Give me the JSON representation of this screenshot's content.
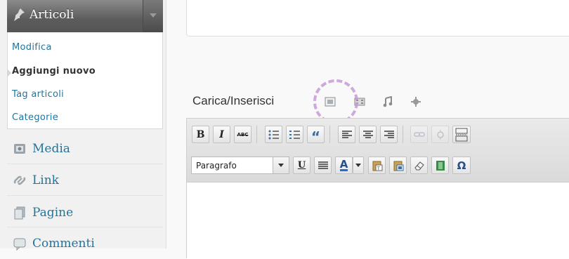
{
  "sidebar": {
    "header": {
      "label": "Articoli",
      "icon": "pushpin-icon"
    },
    "submenu": [
      {
        "label": "Modifica",
        "current": false
      },
      {
        "label": "Aggiungi nuovo",
        "current": true
      },
      {
        "label": "Tag articoli",
        "current": false
      },
      {
        "label": "Categorie",
        "current": false
      }
    ],
    "items": [
      {
        "label": "Media",
        "icon": "media-icon"
      },
      {
        "label": "Link",
        "icon": "link-icon"
      },
      {
        "label": "Pagine",
        "icon": "pages-icon"
      },
      {
        "label": "Commenti",
        "icon": "comments-icon"
      }
    ]
  },
  "upload": {
    "label": "Carica/Inserisci",
    "icons": [
      "add-image-icon",
      "add-video-icon",
      "add-audio-icon",
      "add-media-icon"
    ]
  },
  "editor": {
    "toolbar_row1": [
      "bold",
      "italic",
      "strikethrough",
      "bullet-list",
      "numbered-list",
      "blockquote",
      "align-left",
      "align-center",
      "align-right",
      "insert-link",
      "remove-link",
      "insert-more"
    ],
    "toolbar_row1_text": {
      "bold": "B",
      "italic": "I",
      "strikethrough": "ABC",
      "blockquote": "“"
    },
    "format_select": {
      "value": "Paragrafo"
    },
    "toolbar_row2_text": {
      "underline": "U",
      "text_color": "A",
      "special_char": "Ω"
    }
  },
  "colors": {
    "link": "#21759b",
    "sidebar_head": "#5c5c5c",
    "circle_highlight": "#c89ad8"
  }
}
